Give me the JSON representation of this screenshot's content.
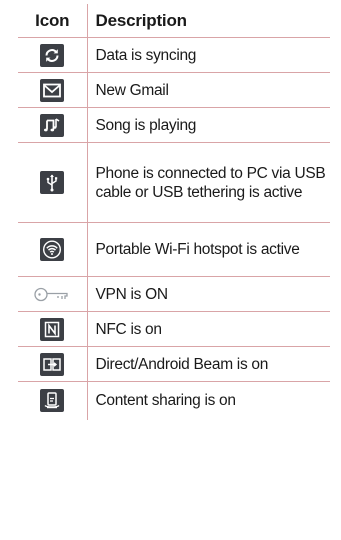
{
  "table": {
    "headers": {
      "icon": "Icon",
      "description": "Description"
    },
    "rows": [
      {
        "icon": "sync-icon",
        "description": "Data is syncing"
      },
      {
        "icon": "gmail-icon",
        "description": "New Gmail"
      },
      {
        "icon": "music-note-icon",
        "description": "Song is playing"
      },
      {
        "icon": "usb-icon",
        "description": "Phone is connected to PC via USB cable or USB tethering is active"
      },
      {
        "icon": "wifi-hotspot-icon",
        "description": "Portable Wi-Fi hotspot is active"
      },
      {
        "icon": "vpn-key-icon",
        "description": "VPN is ON"
      },
      {
        "icon": "nfc-icon",
        "description": "NFC is on"
      },
      {
        "icon": "android-beam-icon",
        "description": "Direct/Android Beam is on"
      },
      {
        "icon": "content-sharing-icon",
        "description": "Content sharing is on"
      }
    ]
  },
  "colors": {
    "border": "#d9a4a7",
    "icon_bg": "#3c3f45",
    "icon_fg": "#ffffff",
    "key_stroke": "#9aa0a6"
  }
}
